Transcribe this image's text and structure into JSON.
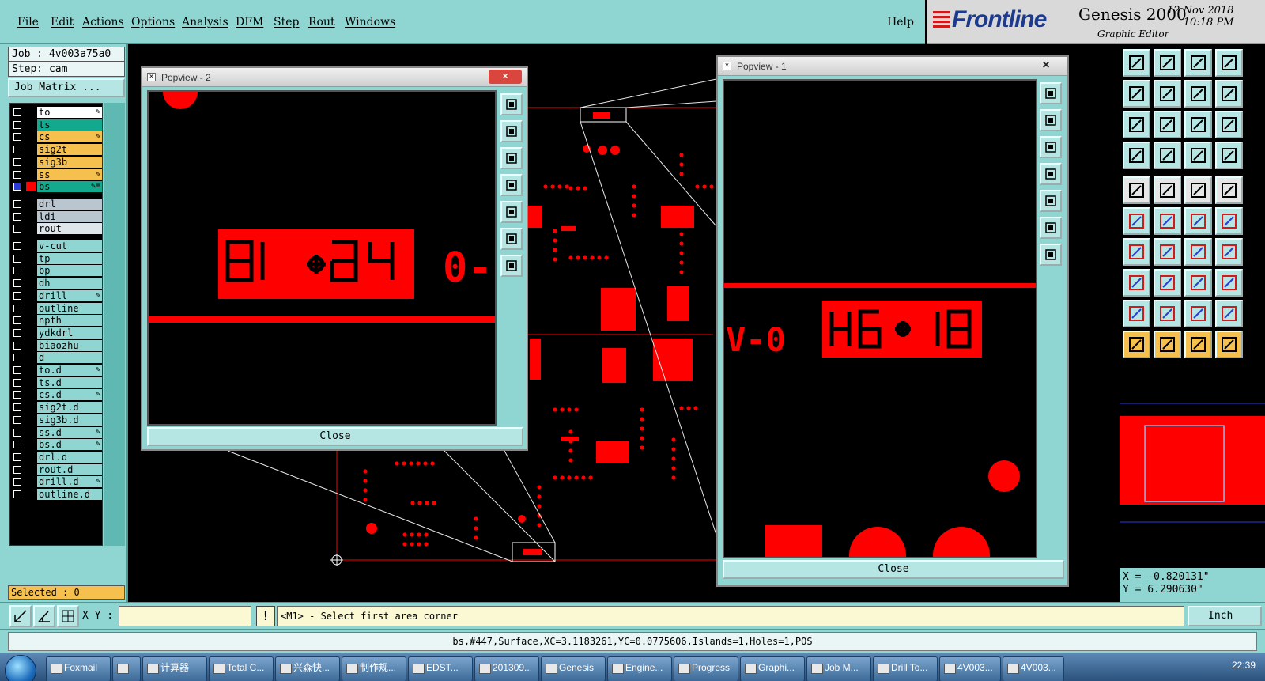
{
  "menubar": {
    "items": [
      {
        "label": "File",
        "hotkey": "F"
      },
      {
        "label": "Edit",
        "hotkey": "E"
      },
      {
        "label": "Actions",
        "hotkey": "A"
      },
      {
        "label": "Options",
        "hotkey": "O"
      },
      {
        "label": "Analysis",
        "hotkey": "n"
      },
      {
        "label": "DFM",
        "hotkey": "D"
      },
      {
        "label": "Step",
        "hotkey": "S"
      },
      {
        "label": "Rout",
        "hotkey": "R"
      },
      {
        "label": "Windows",
        "hotkey": "W"
      }
    ],
    "help": "Help"
  },
  "brand": {
    "logo": "Frontline",
    "product": "Genesis 2000",
    "subtitle": "Graphic Editor",
    "date": "12 Nov 2018",
    "time": "10:18 PM"
  },
  "job": {
    "job_line": "Job : 4v003a75a0",
    "step_line": "Step: cam",
    "matrix_button": "Job Matrix ..."
  },
  "layers": [
    {
      "name": "to",
      "color": "#ffffff",
      "flag": "✎",
      "group": 0
    },
    {
      "name": "ts",
      "color": "#12a98e",
      "flag": "",
      "group": 0
    },
    {
      "name": "cs",
      "color": "#f6c04e",
      "flag": "✎",
      "group": 0
    },
    {
      "name": "sig2t",
      "color": "#f6c04e",
      "flag": "",
      "group": 0
    },
    {
      "name": "sig3b",
      "color": "#f6c04e",
      "flag": "",
      "group": 0
    },
    {
      "name": "ss",
      "color": "#f6c04e",
      "flag": "✎",
      "group": 0
    },
    {
      "name": "bs",
      "color": "#12a98e",
      "flag": "✎≡",
      "group": 0,
      "active": true
    },
    {
      "name": "drl",
      "color": "#b9c6cf",
      "flag": "",
      "group": 1
    },
    {
      "name": "ldi",
      "color": "#b9c6cf",
      "flag": "",
      "group": 1
    },
    {
      "name": "rout",
      "color": "#dfe6ea",
      "flag": "",
      "group": 1
    },
    {
      "name": "v-cut",
      "color": "#8fd6d2",
      "flag": "",
      "group": 2
    },
    {
      "name": "tp",
      "color": "#8fd6d2",
      "flag": "",
      "group": 2
    },
    {
      "name": "bp",
      "color": "#8fd6d2",
      "flag": "",
      "group": 2
    },
    {
      "name": "dh",
      "color": "#8fd6d2",
      "flag": "",
      "group": 2
    },
    {
      "name": "drill",
      "color": "#8fd6d2",
      "flag": "✎",
      "group": 2
    },
    {
      "name": "outline",
      "color": "#8fd6d2",
      "flag": "",
      "group": 2
    },
    {
      "name": "npth",
      "color": "#8fd6d2",
      "flag": "",
      "group": 2
    },
    {
      "name": "ydkdrl",
      "color": "#8fd6d2",
      "flag": "",
      "group": 2
    },
    {
      "name": "biaozhu",
      "color": "#8fd6d2",
      "flag": "",
      "group": 2
    },
    {
      "name": "d",
      "color": "#8fd6d2",
      "flag": "",
      "group": 2
    },
    {
      "name": "to.d",
      "color": "#8fd6d2",
      "flag": "✎",
      "group": 2
    },
    {
      "name": "ts.d",
      "color": "#8fd6d2",
      "flag": "",
      "group": 2
    },
    {
      "name": "cs.d",
      "color": "#8fd6d2",
      "flag": "✎",
      "group": 2
    },
    {
      "name": "sig2t.d",
      "color": "#8fd6d2",
      "flag": "",
      "group": 2
    },
    {
      "name": "sig3b.d",
      "color": "#8fd6d2",
      "flag": "",
      "group": 2
    },
    {
      "name": "ss.d",
      "color": "#8fd6d2",
      "flag": "✎",
      "group": 2
    },
    {
      "name": "bs.d",
      "color": "#8fd6d2",
      "flag": "✎",
      "group": 2
    },
    {
      "name": "drl.d",
      "color": "#8fd6d2",
      "flag": "",
      "group": 2
    },
    {
      "name": "rout.d",
      "color": "#8fd6d2",
      "flag": "",
      "group": 2
    },
    {
      "name": "drill.d",
      "color": "#8fd6d2",
      "flag": "✎",
      "group": 2
    },
    {
      "name": "outline.d",
      "color": "#8fd6d2",
      "flag": "",
      "group": 2
    }
  ],
  "selected": "Selected : 0",
  "popview2": {
    "title": "Popview - 2",
    "close_label": "Close",
    "glyph_text": "0-"
  },
  "popview1": {
    "title": "Popview - 1",
    "close_label": "Close",
    "glyph_text": "V-0"
  },
  "coords": {
    "x": "X = -0.820131\"",
    "y": "Y = 6.290630\""
  },
  "command": {
    "xy_label": "X Y :",
    "xy_value": "",
    "warn": "!",
    "prompt": "<M1> - Select first area corner",
    "unit": "Inch"
  },
  "status": "bs,#447,Surface,XC=3.1183261,YC=0.0775606,Islands=1,Holes=1,POS",
  "taskbar": {
    "tasks": [
      "Foxmail",
      "",
      "计算器",
      "Total C...",
      "兴森快...",
      "制作规...",
      "EDST...",
      "201309...",
      "Genesis",
      "Engine...",
      "Progress",
      "Graphi...",
      "Job M...",
      "Drill To...",
      "4V003...",
      "4V003..."
    ],
    "clock": "22:39"
  },
  "colors": {
    "panel": "#8fd6d2",
    "feature": "#ff0000",
    "button": "#b6e6e3",
    "highlight": "#f6c04e"
  }
}
